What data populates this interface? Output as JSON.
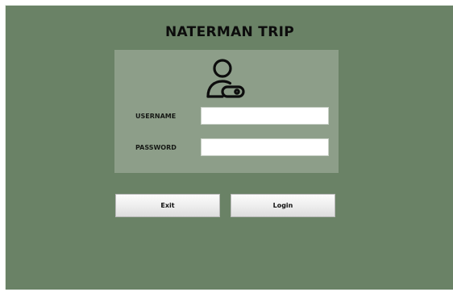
{
  "window": {
    "title": "NATERMAN TRIP",
    "background": "#6a8266",
    "panel_background": "#8d9e89"
  },
  "login_form": {
    "icon": "user-key-icon",
    "username_label": "USERNAME",
    "username_value": "",
    "password_label": "PASSWORD",
    "password_value": ""
  },
  "buttons": {
    "exit_label": "Exit",
    "login_label": "Login"
  }
}
